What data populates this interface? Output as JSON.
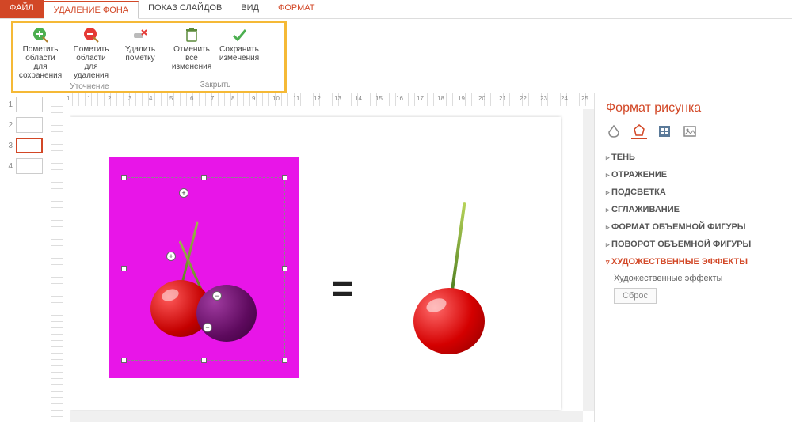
{
  "tabs": {
    "file": "ФАЙЛ",
    "bgremove": "УДАЛЕНИЕ ФОНА",
    "slideshow": "ПОКАЗ СЛАЙДОВ",
    "view": "ВИД",
    "format": "ФОРМАТ"
  },
  "ribbon": {
    "refine_group": "Уточнение",
    "close_group": "Закрыть",
    "mark_keep_l1": "Пометить области",
    "mark_keep_l2": "для сохранения",
    "mark_remove_l1": "Пометить области",
    "mark_remove_l2": "для удаления",
    "delete_mark_l1": "Удалить",
    "delete_mark_l2": "пометку",
    "discard_l1": "Отменить все",
    "discard_l2": "изменения",
    "keep_l1": "Сохранить",
    "keep_l2": "изменения"
  },
  "ruler_marks": [
    "1",
    "1",
    "2",
    "3",
    "4",
    "5",
    "6",
    "7",
    "8",
    "9",
    "10",
    "11",
    "12",
    "13",
    "14",
    "15",
    "16",
    "17",
    "18",
    "19",
    "20",
    "21",
    "22",
    "23",
    "24",
    "25"
  ],
  "thumbs": [
    1,
    2,
    3,
    4
  ],
  "thumb_selected": 3,
  "equals": "=",
  "side": {
    "title": "Формат рисунка",
    "items": [
      "ТЕНЬ",
      "ОТРАЖЕНИЕ",
      "ПОДСВЕТКА",
      "СГЛАЖИВАНИЕ",
      "ФОРМАТ ОБЪЕМНОЙ ФИГУРЫ",
      "ПОВОРОТ ОБЪЕМНОЙ ФИГУРЫ",
      "ХУДОЖЕСТВЕННЫЕ ЭФФЕКТЫ"
    ],
    "open_index": 6,
    "artistic_label": "Художественные эффекты",
    "reset": "Сброс"
  }
}
